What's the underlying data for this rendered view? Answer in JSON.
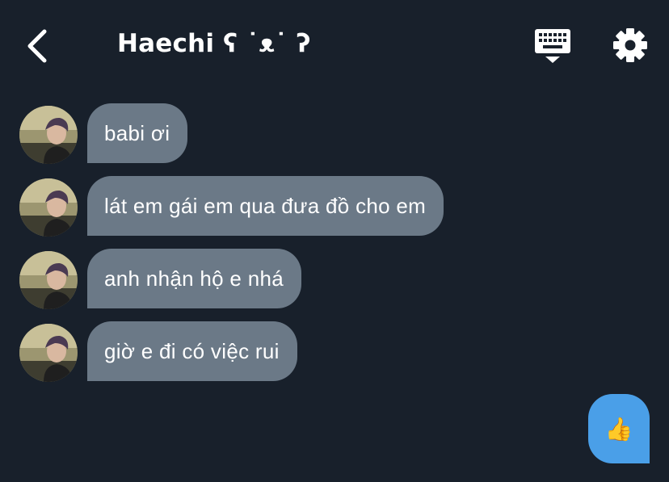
{
  "header": {
    "title": "Haechi ʕ ˙ᴥ˙ ʔ",
    "back_icon": "chevron-left-icon",
    "keyboard_icon": "keyboard-icon",
    "settings_icon": "gear-icon"
  },
  "messages": [
    {
      "text": "babi ơi"
    },
    {
      "text": "lát em gái em qua đưa đồ cho em"
    },
    {
      "text": "anh nhận hộ e nhá"
    },
    {
      "text": "giờ e đi có việc rui"
    }
  ],
  "sent": {
    "emoji": "👍"
  },
  "colors": {
    "background": "#18202b",
    "received_bubble": "#6b7987",
    "sent_bubble": "#4a9fe8"
  }
}
